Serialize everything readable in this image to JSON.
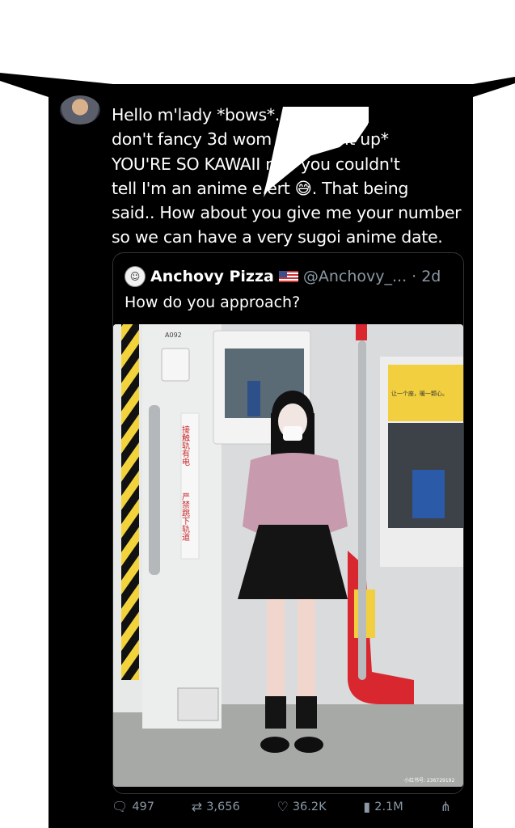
{
  "reply": {
    "text": "Hello m'lady *bows*. I typically don't fancy 3d women but *eyes light up* YOU'RE SO KAWAII! I'm an anime expert 😂. That being said.. How about you give me your number so we can have a very sugoi anime date.",
    "lines": [
      "Hello m'lady *bows*.          typically",
      "don't fancy 3d wom          eyes light up*",
      "YOU'RE SO KAWAII       n, if you couldn't",
      "tell I'm an anime e    ert 😅. That being",
      "said.. How about you give me your number",
      "so we can have a very sugoi anime date."
    ]
  },
  "quote": {
    "name": "Anchovy Pizza",
    "handle": "@Anchovy_...",
    "time": "· 2d",
    "text": "How do you approach?",
    "photo": {
      "door_code": "A092",
      "sign_text_1": "接触轨有电",
      "sign_text_2": "严禁跳下轨道",
      "banner_text": "让一个座，暖一颗心。",
      "watermark": "小红书号: 236729192",
      "colors": {
        "car_wall": "#d8dadb",
        "pole": "#b8bcbf",
        "handrail_red": "#d8272f",
        "banner_yellow": "#f1cf3f",
        "blouse": "#c79aae",
        "skirt": "#141414"
      }
    }
  },
  "actions": {
    "replies": "497",
    "reposts": "3,656",
    "likes": "36.2K",
    "views": "2.1M"
  },
  "icons": [
    "reply-icon",
    "repost-icon",
    "like-icon",
    "views-icon",
    "share-icon"
  ]
}
